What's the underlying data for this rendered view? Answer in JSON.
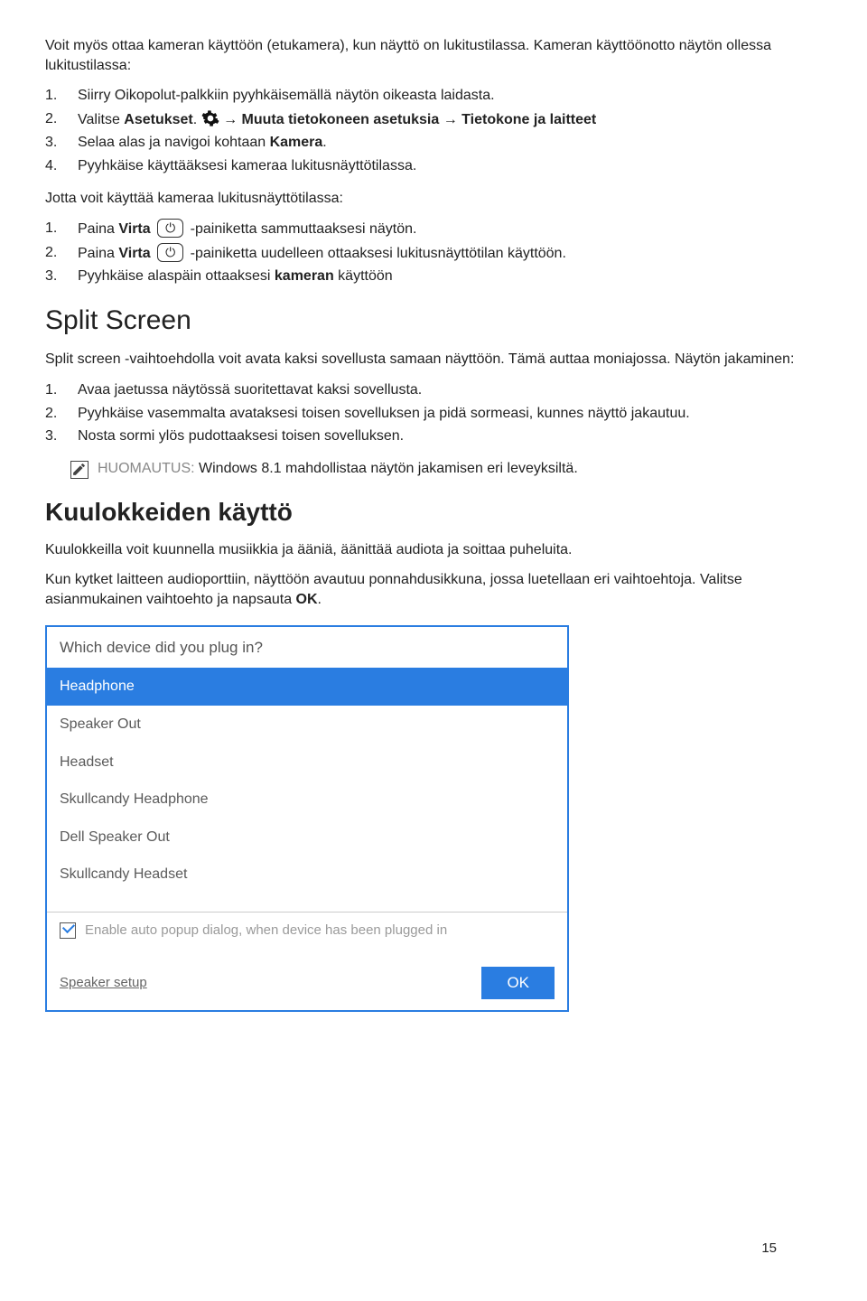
{
  "intro1": "Voit myös ottaa kameran käyttöön (etukamera), kun näyttö on lukitustilassa. Kameran käyttöönotto näytön ollessa lukitustilassa:",
  "list1": {
    "i1": {
      "n": "1.",
      "t": "Siirry Oikopolut-palkkiin pyyhkäisemällä näytön oikeasta laidasta."
    },
    "i2": {
      "n": "2.",
      "t_a": "Valitse ",
      "t_b": "Asetukset",
      "t_c": ". ",
      "t_d": " → Muuta tietokoneen asetuksia → Tietokone ja laitteet"
    },
    "i3": {
      "n": "3.",
      "t_a": "Selaa alas ja navigoi kohtaan ",
      "t_b": "Kamera",
      "t_c": "."
    },
    "i4": {
      "n": "4.",
      "t": "Pyyhkäise käyttääksesi kameraa lukitusnäyttötilassa."
    }
  },
  "intro2": "Jotta voit käyttää kameraa lukitusnäyttötilassa:",
  "list2": {
    "i1": {
      "n": "1.",
      "a": "Paina ",
      "b": "Virta",
      "c": " -painiketta sammuttaaksesi näytön."
    },
    "i2": {
      "n": "2.",
      "a": "Paina ",
      "b": "Virta",
      "c": " -painiketta uudelleen ottaaksesi lukitusnäyttötilan käyttöön."
    },
    "i3": {
      "n": "3.",
      "a": "Pyyhkäise alaspäin ottaaksesi ",
      "b": "kameran",
      "c": " käyttöön"
    }
  },
  "h_split": "Split Screen",
  "split_intro": "Split screen -vaihtoehdolla voit avata kaksi sovellusta samaan näyttöön. Tämä auttaa moniajossa. Näytön jakaminen:",
  "list3": {
    "i1": {
      "n": "1.",
      "t": "Avaa jaetussa näytössä suoritettavat kaksi sovellusta."
    },
    "i2": {
      "n": "2.",
      "t": "Pyyhkäise vasemmalta avataksesi toisen sovelluksen ja pidä sormeasi, kunnes näyttö jakautuu."
    },
    "i3": {
      "n": "3.",
      "t": "Nosta sormi ylös pudottaaksesi toisen sovelluksen."
    }
  },
  "note_label": "HUOMAUTUS:",
  "note_text": " Windows 8.1 mahdollistaa näytön jakamisen eri leveyksiltä.",
  "h_head": "Kuulokkeiden käyttö",
  "head_p1": "Kuulokkeilla voit kuunnella musiikkia ja ääniä, äänittää audiota ja soittaa puheluita.",
  "head_p2_a": "Kun kytket laitteen audioporttiin, näyttöön avautuu ponnahdusikkuna, jossa luetellaan eri vaihtoehtoja. Valitse asianmukainen vaihtoehto ja napsauta ",
  "head_p2_b": "OK",
  "head_p2_c": ".",
  "dialog": {
    "title": "Which device did you plug in?",
    "items": [
      "Headphone",
      "Speaker Out",
      "Headset",
      "Skullcandy Headphone",
      "Dell Speaker Out",
      "Skullcandy Headset"
    ],
    "chk_label": "Enable auto popup dialog, when device has been plugged in",
    "link": "Speaker setup",
    "ok": "OK"
  },
  "page_num": "15"
}
